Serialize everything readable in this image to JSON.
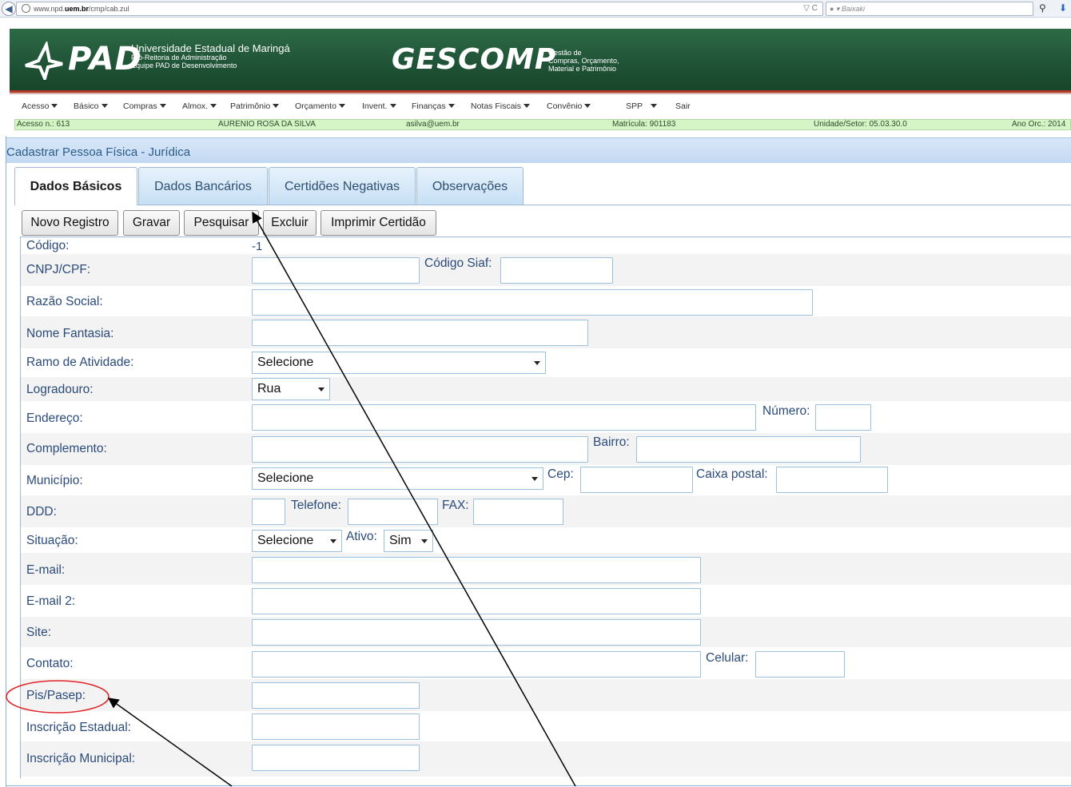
{
  "browser": {
    "url_prefix": "www.npd.",
    "url_domain": "uem.br",
    "url_path": "/cmp/cab.zul",
    "url_icons": "▽ C",
    "search_placeholder": "Baixaki"
  },
  "banner": {
    "logo_text": "PAD",
    "university_line1": "Universidade Estadual de Maringá",
    "university_line2": "Pró-Reitoria de Administração",
    "university_line3": "Equipe PAD de Desenvolvimento",
    "system_name": "GESCOMP",
    "system_desc_line1": "Gestão de",
    "system_desc_line2": "Compras, Orçamento,",
    "system_desc_line3": "Material e Patrimônio"
  },
  "menu": {
    "items": [
      {
        "label": "Acesso"
      },
      {
        "label": "Básico"
      },
      {
        "label": "Compras"
      },
      {
        "label": "Almox."
      },
      {
        "label": "Patrimônio"
      },
      {
        "label": "Orçamento"
      },
      {
        "label": "Invent."
      },
      {
        "label": "Finanças"
      },
      {
        "label": "Notas Fiscais"
      },
      {
        "label": "Convênio"
      },
      {
        "label": "SPP"
      }
    ],
    "exit_label": "Sair"
  },
  "info": {
    "access": "Acesso n.: 613",
    "user_name": "AURENIO ROSA DA SILVA",
    "email": "asilva@uem.br",
    "registration": "Matrícula: 901183",
    "unit": "Unidade/Setor: 05.03.30.0",
    "budget_year": "Ano Orc.: 2014"
  },
  "page": {
    "title": "Cadastrar Pessoa Física - Jurídica"
  },
  "tabs": [
    {
      "label": "Dados Básicos",
      "active": true
    },
    {
      "label": "Dados Bancários",
      "active": false
    },
    {
      "label": "Certidões Negativas",
      "active": false
    },
    {
      "label": "Observações",
      "active": false
    }
  ],
  "toolbar": {
    "new_label": "Novo Registro",
    "save_label": "Gravar",
    "search_label": "Pesquisar",
    "delete_label": "Excluir",
    "print_label": "Imprimir Certidão"
  },
  "form": {
    "codigo_label": "Código:",
    "codigo_value": "-1",
    "cnpj_label": "CNPJ/CPF:",
    "cnpj_value": "",
    "siaf_label": "Código Siaf:",
    "siaf_value": "",
    "razao_label": "Razão Social:",
    "razao_value": "",
    "fantasia_label": "Nome Fantasia:",
    "fantasia_value": "",
    "ramo_label": "Ramo de Atividade:",
    "ramo_value": "Selecione",
    "logradouro_label": "Logradouro:",
    "logradouro_value": "Rua",
    "endereco_label": "Endereço:",
    "endereco_value": "",
    "numero_label": "Número:",
    "numero_value": "",
    "complemento_label": "Complemento:",
    "complemento_value": "",
    "bairro_label": "Bairro:",
    "bairro_value": "",
    "municipio_label": "Município:",
    "municipio_value": "Selecione",
    "cep_label": "Cep:",
    "cep_value": "",
    "caixa_label": "Caixa postal:",
    "caixa_value": "",
    "ddd_label": "DDD:",
    "ddd_value": "",
    "telefone_label": "Telefone:",
    "telefone_value": "",
    "fax_label": "FAX:",
    "fax_value": "",
    "situacao_label": "Situação:",
    "situacao_value": "Selecione",
    "ativo_label": "Ativo:",
    "ativo_value": "Sim",
    "email_label": "E-mail:",
    "email_value": "",
    "email2_label": "E-mail 2:",
    "email2_value": "",
    "site_label": "Site:",
    "site_value": "",
    "contato_label": "Contato:",
    "contato_value": "",
    "celular_label": "Celular:",
    "celular_value": "",
    "pis_label": "Pis/Pasep:",
    "pis_value": "",
    "ie_label": "Inscrição Estadual:",
    "ie_value": "",
    "im_label": "Inscrição Municipal:",
    "im_value": ""
  },
  "colors": {
    "banner_green": "#1f5236",
    "accent_blue": "#2b4b7b",
    "info_green": "#d6f5c6",
    "annotation_red": "#e0262a"
  }
}
